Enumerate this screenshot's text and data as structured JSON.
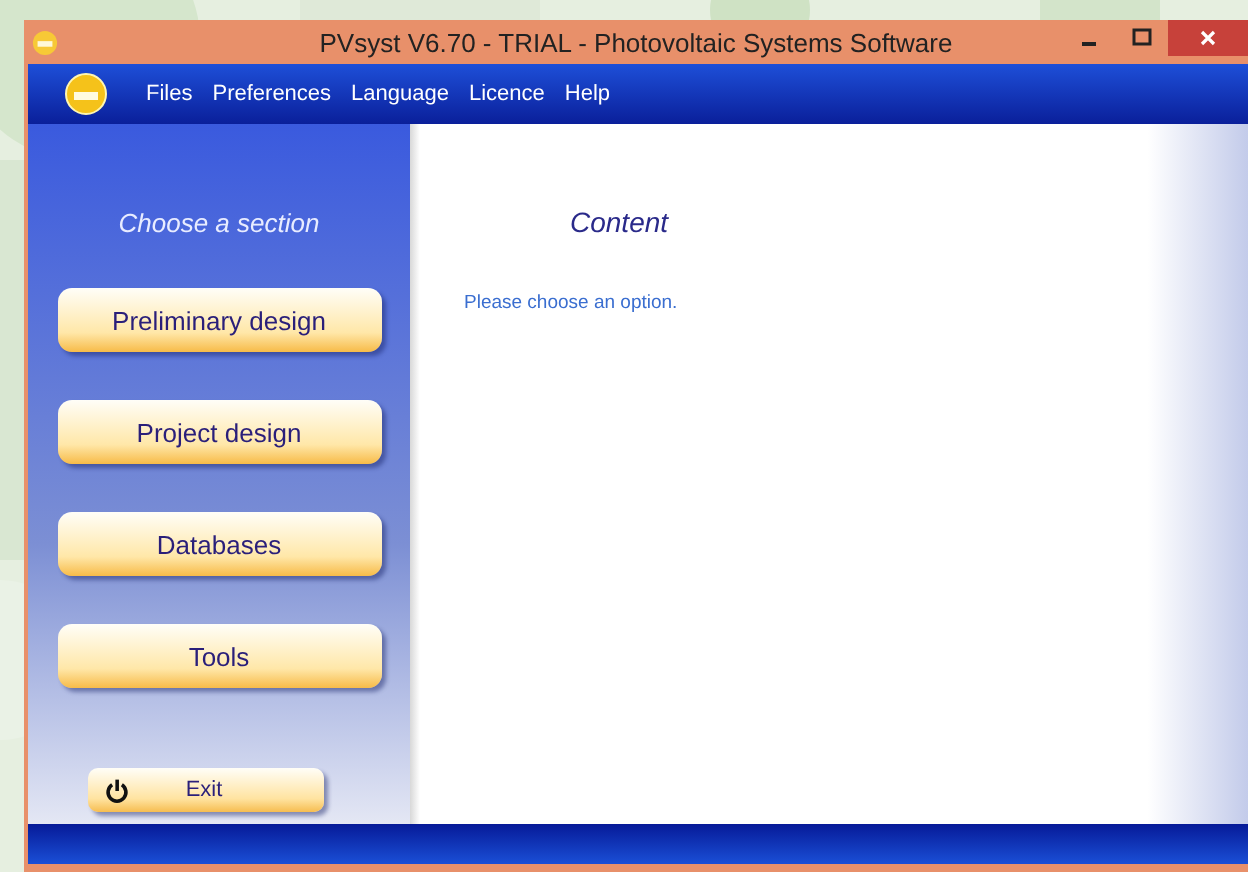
{
  "window": {
    "title": "PVsyst V6.70 - TRIAL - Photovoltaic Systems Software"
  },
  "menu": [
    "Files",
    "Preferences",
    "Language",
    "Licence",
    "Help"
  ],
  "sidebar": {
    "heading": "Choose a section",
    "buttons": [
      "Preliminary design",
      "Project design",
      "Databases",
      "Tools"
    ],
    "exit": "Exit"
  },
  "content": {
    "heading": "Content",
    "message": "Please choose an option."
  }
}
